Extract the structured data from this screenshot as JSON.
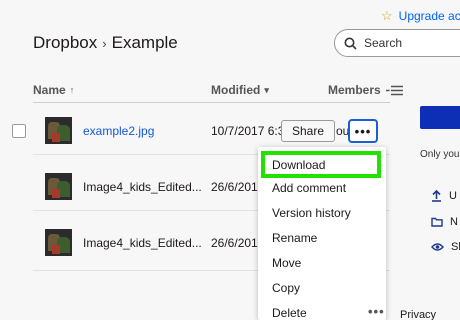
{
  "header": {
    "upgrade_label": "Upgrade acc",
    "breadcrumb": [
      "Dropbox",
      "Example"
    ],
    "breadcrumb_separator": "›",
    "search_placeholder": "Search"
  },
  "columns": {
    "name": "Name",
    "name_sort_icon": "arrow-up",
    "modified": "Modified",
    "modified_sort_icon": "chevron-down",
    "members": "Members",
    "view_icon": "list-view-icon"
  },
  "rows": [
    {
      "name": "example2.jpg",
      "modified": "10/7/2017 6:3",
      "members_trail": "ou",
      "selected": true
    },
    {
      "name": "Image4_kids_Edited...",
      "modified": "26/6/201"
    },
    {
      "name": "Image4_kids_Edited...",
      "modified": "26/6/201"
    }
  ],
  "row_actions": {
    "share_label": "Share",
    "more_label": "•••"
  },
  "context_menu": {
    "items": [
      "Download",
      "Add comment",
      "Version history",
      "Rename",
      "Move",
      "Copy",
      "Delete"
    ],
    "highlighted": "Download",
    "highlight_color": "#22e000"
  },
  "right_panel": {
    "only_you_text": "Only you ha",
    "items": [
      {
        "icon": "upload-icon",
        "label": "U"
      },
      {
        "icon": "folder-icon",
        "label": "N"
      },
      {
        "icon": "eye-icon",
        "label": "Sh"
      }
    ]
  },
  "footer": {
    "more_label": "•••",
    "privacy_label": "Privacy"
  },
  "colors": {
    "accent": "#0061fe",
    "selected_text": "#0f5ad4",
    "primary_button": "#0d2fb5",
    "focus_border": "#1b5fd6"
  }
}
